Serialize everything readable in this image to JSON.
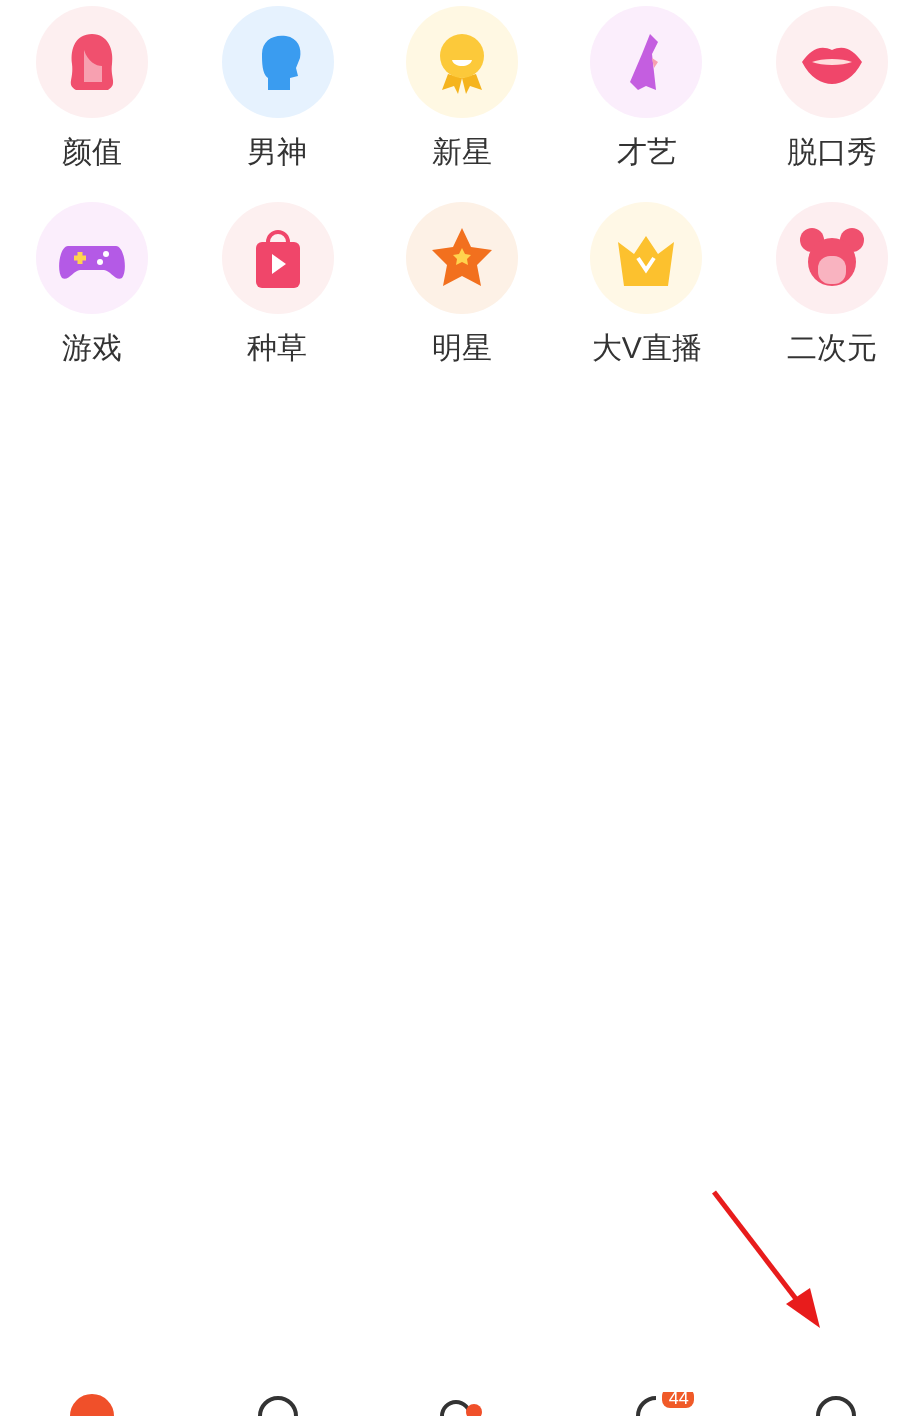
{
  "categories": [
    {
      "label": "颜值",
      "kind": "hair"
    },
    {
      "label": "男神",
      "kind": "head"
    },
    {
      "label": "新星",
      "kind": "medal"
    },
    {
      "label": "才艺",
      "kind": "dance"
    },
    {
      "label": "脱口秀",
      "kind": "lips"
    },
    {
      "label": "游戏",
      "kind": "gamepad"
    },
    {
      "label": "种草",
      "kind": "bag"
    },
    {
      "label": "明星",
      "kind": "star"
    },
    {
      "label": "大V直播",
      "kind": "crown"
    },
    {
      "label": "二次元",
      "kind": "girl"
    }
  ],
  "tab_bar": [
    {
      "kind": "home",
      "selected": true
    },
    {
      "kind": "search",
      "selected": false
    },
    {
      "kind": "friends",
      "selected": false
    },
    {
      "kind": "chat",
      "selected": false,
      "badge": "44"
    },
    {
      "kind": "profile",
      "selected": false
    }
  ]
}
